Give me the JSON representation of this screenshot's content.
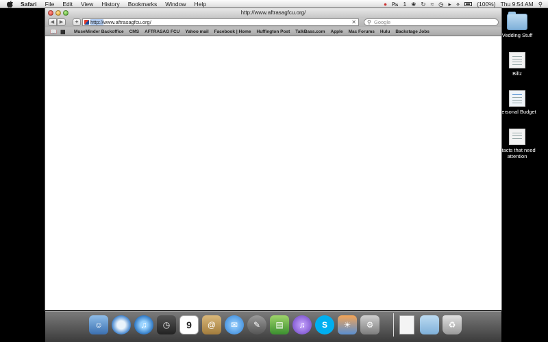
{
  "menubar": {
    "app_name": "Safari",
    "menus": [
      "File",
      "Edit",
      "View",
      "History",
      "Bookmarks",
      "Window",
      "Help"
    ],
    "status_number": "1",
    "battery_text": "(100%)",
    "clock": "Thu 9:54 AM"
  },
  "desktop": {
    "items": [
      {
        "label": "Vedding Stuff",
        "icon": "folder-icon"
      },
      {
        "label": "Billz",
        "icon": "document-icon"
      },
      {
        "label": "Personal Budget",
        "icon": "spreadsheet-icon"
      },
      {
        "label": "ntacts that need attention",
        "icon": "pages-document-icon"
      }
    ]
  },
  "window": {
    "title": "http://www.aftrasagfcu.org/",
    "address_selected": "http://",
    "address_rest": "www.aftrasagfcu.org/",
    "search_placeholder": "Google",
    "bookmarks": [
      "MuseMinder Backoffice",
      "CMS",
      "AFTRASAG FCU",
      "Yahoo mail",
      "Facebook | Home",
      "Huffington Post",
      "TalkBass.com",
      "Apple",
      "Mac Forums",
      "Hulu",
      "Backstage Jobs"
    ]
  },
  "dock": {
    "calendar_day": "9",
    "items": [
      "finder-icon",
      "safari-icon",
      "itunes-icon",
      "time-machine-icon",
      "calendar-icon",
      "address-book-icon",
      "ichat-icon",
      "scripting-icon",
      "numbers-icon",
      "itunes-store-icon",
      "skype-icon",
      "iphoto-icon",
      "system-preferences-icon",
      "document-icon",
      "folder-icon",
      "trash-icon"
    ]
  },
  "colors": {
    "address_selection": "#b2cdf3",
    "desktop_background": "#000000"
  }
}
